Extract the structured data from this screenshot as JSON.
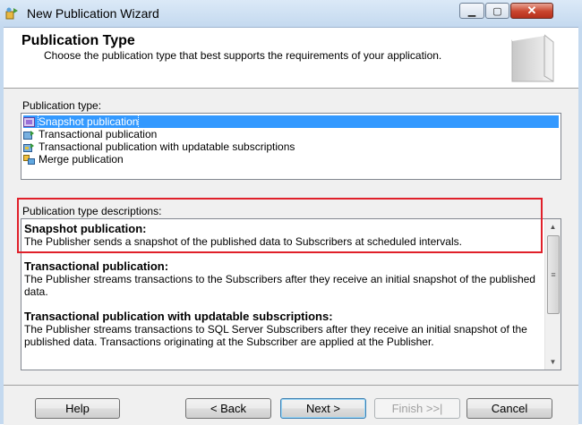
{
  "window": {
    "title": "New Publication Wizard"
  },
  "header": {
    "title": "Publication Type",
    "subtitle": "Choose the publication type that best supports the requirements of your application."
  },
  "publication_type": {
    "label": "Publication type:",
    "items": [
      {
        "label": "Snapshot publication",
        "icon": "snapshot-publication-icon",
        "selected": true
      },
      {
        "label": "Transactional publication",
        "icon": "transactional-publication-icon",
        "selected": false
      },
      {
        "label": "Transactional publication with updatable subscriptions",
        "icon": "updatable-publication-icon",
        "selected": false
      },
      {
        "label": "Merge publication",
        "icon": "merge-publication-icon",
        "selected": false
      }
    ]
  },
  "descriptions": {
    "label": "Publication type descriptions:",
    "items": [
      {
        "title": "Snapshot publication:",
        "text": "The Publisher sends a snapshot of the published data to Subscribers at scheduled intervals."
      },
      {
        "title": "Transactional publication:",
        "text": "The Publisher streams transactions to the Subscribers after they receive an initial snapshot of the published data."
      },
      {
        "title": "Transactional publication with updatable subscriptions:",
        "text": "The Publisher streams transactions to SQL Server Subscribers after they receive an initial snapshot of the published data. Transactions originating at the Subscriber are applied at the Publisher."
      }
    ]
  },
  "footer": {
    "help": "Help",
    "back": "< Back",
    "next": "Next >",
    "finish": "Finish >>|",
    "cancel": "Cancel"
  },
  "colors": {
    "selection": "#3399ff",
    "highlight_box": "#e0202a"
  }
}
